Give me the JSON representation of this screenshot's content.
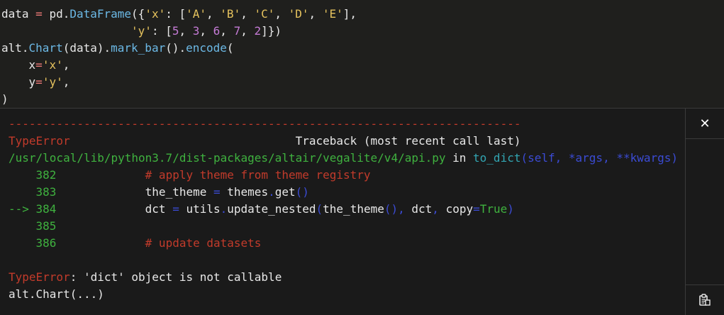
{
  "code_cell": {
    "lines": [
      [
        {
          "t": "data ",
          "c": "default"
        },
        {
          "t": "=",
          "c": "op"
        },
        {
          "t": " pd.",
          "c": "default"
        },
        {
          "t": "DataFrame",
          "c": "attr"
        },
        {
          "t": "({",
          "c": "default"
        },
        {
          "t": "'x'",
          "c": "str"
        },
        {
          "t": ": [",
          "c": "default"
        },
        {
          "t": "'A'",
          "c": "str"
        },
        {
          "t": ", ",
          "c": "default"
        },
        {
          "t": "'B'",
          "c": "str"
        },
        {
          "t": ", ",
          "c": "default"
        },
        {
          "t": "'C'",
          "c": "str"
        },
        {
          "t": ", ",
          "c": "default"
        },
        {
          "t": "'D'",
          "c": "str"
        },
        {
          "t": ", ",
          "c": "default"
        },
        {
          "t": "'E'",
          "c": "str"
        },
        {
          "t": "],",
          "c": "default"
        }
      ],
      [
        {
          "t": "                   ",
          "c": "default"
        },
        {
          "t": "'y'",
          "c": "str"
        },
        {
          "t": ": [",
          "c": "default"
        },
        {
          "t": "5",
          "c": "num"
        },
        {
          "t": ", ",
          "c": "default"
        },
        {
          "t": "3",
          "c": "num"
        },
        {
          "t": ", ",
          "c": "default"
        },
        {
          "t": "6",
          "c": "num"
        },
        {
          "t": ", ",
          "c": "default"
        },
        {
          "t": "7",
          "c": "num"
        },
        {
          "t": ", ",
          "c": "default"
        },
        {
          "t": "2",
          "c": "num"
        },
        {
          "t": "]})",
          "c": "default"
        }
      ],
      [
        {
          "t": "alt.",
          "c": "default"
        },
        {
          "t": "Chart",
          "c": "attr"
        },
        {
          "t": "(data).",
          "c": "default"
        },
        {
          "t": "mark_bar",
          "c": "attr"
        },
        {
          "t": "().",
          "c": "default"
        },
        {
          "t": "encode",
          "c": "attr"
        },
        {
          "t": "(",
          "c": "default"
        }
      ],
      [
        {
          "t": "    x",
          "c": "default"
        },
        {
          "t": "=",
          "c": "op"
        },
        {
          "t": "'x'",
          "c": "str"
        },
        {
          "t": ",",
          "c": "default"
        }
      ],
      [
        {
          "t": "    y",
          "c": "default"
        },
        {
          "t": "=",
          "c": "op"
        },
        {
          "t": "'y'",
          "c": "str"
        },
        {
          "t": ",",
          "c": "default"
        }
      ],
      [
        {
          "t": ")",
          "c": "default"
        }
      ]
    ]
  },
  "output": {
    "lines": [
      [
        {
          "t": "---------------------------------------------------------------------------",
          "c": "red"
        }
      ],
      [
        {
          "t": "TypeError",
          "c": "red"
        },
        {
          "t": "                                 Traceback (most recent call last)",
          "c": "white"
        }
      ],
      [
        {
          "t": "/usr/local/lib/python3.7/dist-packages/altair/vegalite/v4/api.py",
          "c": "green"
        },
        {
          "t": " in ",
          "c": "white"
        },
        {
          "t": "to_dict",
          "c": "cyan"
        },
        {
          "t": "(self, *args, **kwargs)",
          "c": "blue"
        }
      ],
      [
        {
          "t": "    382",
          "c": "green"
        },
        {
          "t": "             # apply theme from theme registry",
          "c": "red"
        }
      ],
      [
        {
          "t": "    383",
          "c": "green"
        },
        {
          "t": "             the_theme ",
          "c": "white"
        },
        {
          "t": "=",
          "c": "blue"
        },
        {
          "t": " themes",
          "c": "white"
        },
        {
          "t": ".",
          "c": "blue"
        },
        {
          "t": "get",
          "c": "white"
        },
        {
          "t": "()",
          "c": "blue"
        }
      ],
      [
        {
          "t": "--> 384",
          "c": "green"
        },
        {
          "t": "             dct ",
          "c": "white"
        },
        {
          "t": "=",
          "c": "blue"
        },
        {
          "t": " utils",
          "c": "white"
        },
        {
          "t": ".",
          "c": "blue"
        },
        {
          "t": "update_nested",
          "c": "white"
        },
        {
          "t": "(",
          "c": "blue"
        },
        {
          "t": "the_theme",
          "c": "white"
        },
        {
          "t": "(),",
          "c": "blue"
        },
        {
          "t": " dct",
          "c": "white"
        },
        {
          "t": ",",
          "c": "blue"
        },
        {
          "t": " copy",
          "c": "white"
        },
        {
          "t": "=",
          "c": "blue"
        },
        {
          "t": "True",
          "c": "green"
        },
        {
          "t": ")",
          "c": "blue"
        }
      ],
      [
        {
          "t": "    385",
          "c": "green"
        }
      ],
      [
        {
          "t": "    386",
          "c": "green"
        },
        {
          "t": "             # update datasets",
          "c": "red"
        }
      ],
      [],
      [
        {
          "t": "TypeError",
          "c": "red"
        },
        {
          "t": ": 'dict' object is not callable",
          "c": "white"
        }
      ],
      [
        {
          "t": "alt.Chart(...)",
          "c": "white"
        }
      ]
    ]
  },
  "controls": {
    "close_label": "✕",
    "close_icon": "close-icon",
    "copy_icon": "copy-icon"
  },
  "colors": {
    "background": "#1f1f1d",
    "output_background": "#1a1a1a",
    "traceback_red": "#c23b2b",
    "traceback_green": "#3fb23f",
    "traceback_cyan": "#32a6b3",
    "traceback_blue": "#3b4bd4",
    "code_string": "#e6c35e",
    "code_number": "#c57bd6",
    "code_operator": "#ef7a78",
    "code_attribute": "#6cb9e6"
  }
}
